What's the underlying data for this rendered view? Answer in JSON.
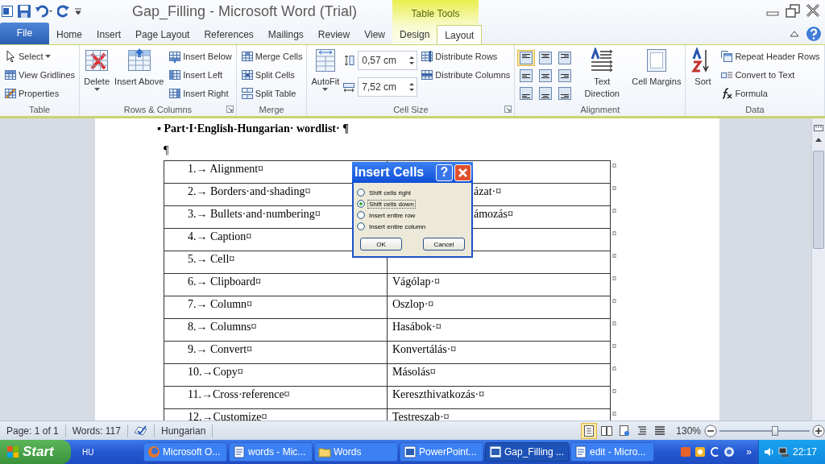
{
  "window": {
    "title": "Gap_Filling - Microsoft Word (Trial)",
    "context_label": "Table Tools"
  },
  "tabs": [
    {
      "label": "File",
      "kind": "file",
      "selected": false
    },
    {
      "label": "Home",
      "kind": "main",
      "selected": false
    },
    {
      "label": "Insert",
      "kind": "main",
      "selected": false
    },
    {
      "label": "Page Layout",
      "kind": "main",
      "selected": false
    },
    {
      "label": "References",
      "kind": "main",
      "selected": false
    },
    {
      "label": "Mailings",
      "kind": "main",
      "selected": false
    },
    {
      "label": "Review",
      "kind": "main",
      "selected": false
    },
    {
      "label": "View",
      "kind": "main",
      "selected": false
    },
    {
      "label": "Design",
      "kind": "contextual",
      "selected": false
    },
    {
      "label": "Layout",
      "kind": "contextual",
      "selected": true
    }
  ],
  "ribbon": [
    {
      "title": "Table",
      "columns": [
        [
          {
            "kind": "small",
            "label": "Select",
            "dropdown": true
          },
          {
            "kind": "small",
            "label": "View Gridlines"
          },
          {
            "kind": "small",
            "label": "Properties"
          }
        ]
      ]
    },
    {
      "title": "Rows & Columns",
      "launcher": true,
      "columns": [
        [
          {
            "kind": "large",
            "label": "Delete",
            "dropdown": true
          }
        ],
        [
          {
            "kind": "large",
            "label": "Insert Above"
          }
        ],
        [
          {
            "kind": "small",
            "label": "Insert Below"
          },
          {
            "kind": "small",
            "label": "Insert Left"
          },
          {
            "kind": "small",
            "label": "Insert Right"
          }
        ]
      ]
    },
    {
      "title": "Merge",
      "columns": [
        [
          {
            "kind": "small",
            "label": "Merge Cells"
          },
          {
            "kind": "small",
            "label": "Split Cells"
          },
          {
            "kind": "small",
            "label": "Split Table"
          }
        ]
      ]
    },
    {
      "title": "Cell Size",
      "launcher": true,
      "columns": [
        [
          {
            "kind": "large",
            "label": "AutoFit",
            "dropdown": true
          }
        ],
        [
          {
            "kind": "spin",
            "value": "0,57 cm"
          },
          {
            "kind": "spin",
            "value": "7,52 cm"
          }
        ],
        [
          {
            "kind": "small",
            "label": "Distribute Rows"
          },
          {
            "kind": "small",
            "label": "Distribute Columns"
          }
        ]
      ]
    },
    {
      "title": "Alignment",
      "columns": [
        [
          {
            "kind": "align",
            "buttons": [
              {
                "selected": true
              },
              {
                "selected": false
              },
              {
                "selected": false
              },
              {
                "selected": false
              },
              {
                "selected": false
              },
              {
                "selected": false
              },
              {
                "selected": false
              },
              {
                "selected": false
              },
              {
                "selected": false
              }
            ]
          }
        ],
        [
          {
            "kind": "large",
            "label": "Text Direction"
          }
        ],
        [
          {
            "kind": "large",
            "label": "Cell Margins"
          }
        ]
      ]
    },
    {
      "title": "Data",
      "columns": [
        [
          {
            "kind": "large",
            "label": "Sort"
          }
        ],
        [
          {
            "kind": "small",
            "label": "Repeat Header Rows"
          },
          {
            "kind": "small",
            "label": "Convert to Text"
          },
          {
            "kind": "small",
            "label": "Formula"
          }
        ]
      ]
    }
  ],
  "document": {
    "heading": "▪ Part·I·English-Hungarian· wordlist· ¶",
    "blank_line": "¶",
    "rows": [
      {
        "term": "1.→ Alignment¤",
        "row_end": "¤"
      },
      {
        "term": "2.→ Borders·and·shading¤",
        "translation": "ázat·¤",
        "partly_covered": true,
        "row_end": "¤"
      },
      {
        "term": "3.→ Bullets·and·numbering¤",
        "translation": "ámozás¤",
        "partly_covered": true,
        "row_end": "¤"
      },
      {
        "term": "4.→ Caption¤",
        "row_end": "¤"
      },
      {
        "term": "5.→ Cell¤",
        "row_end": "¤"
      },
      {
        "term": "6.→ Clipboard¤",
        "translation": "Vágólap·¤",
        "row_end": "¤"
      },
      {
        "term": "7.→ Column¤",
        "translation": "Oszlop·¤",
        "row_end": "¤"
      },
      {
        "term": "8.→ Columns¤",
        "translation": "Hasábok·¤",
        "row_end": "¤"
      },
      {
        "term": "9.→ Convert¤",
        "translation": "Konvertálás·¤",
        "row_end": "¤"
      },
      {
        "term": "10.→Copy¤",
        "translation": "Másolás¤",
        "row_end": "¤"
      },
      {
        "term": "11.→Cross·reference¤",
        "translation": "Kereszthivatkozás·¤",
        "row_end": "¤"
      },
      {
        "term": "12.→Customize¤",
        "translation": "Testreszab·¤",
        "row_end": "¤"
      }
    ]
  },
  "dialog": {
    "title": "Insert Cells",
    "help": "?",
    "options": [
      {
        "label": "Shift cells right",
        "selected": false
      },
      {
        "label": "Shift cells down",
        "selected": true
      },
      {
        "label": "Insert entire row",
        "selected": false
      },
      {
        "label": "Insert entire column",
        "selected": false
      }
    ],
    "buttons": [
      "OK",
      "Cancel"
    ]
  },
  "status_bar": {
    "page": "Page: 1 of 1",
    "words": "Words: 117",
    "language": "Hungarian",
    "views": [
      {
        "selected": true
      },
      {
        "selected": false
      },
      {
        "selected": false
      },
      {
        "selected": false
      },
      {
        "selected": false
      }
    ],
    "zoom": "130%",
    "zoom_slider": {
      "level": 0.62
    }
  },
  "taskbar": {
    "start": "Start",
    "language": "HU",
    "items": [
      {
        "label": "Microsoft O...",
        "selected": false
      },
      {
        "label": "words - Mic...",
        "selected": false
      },
      {
        "label": "Words",
        "selected": false
      },
      {
        "label": "PowerPoint...",
        "selected": false
      },
      {
        "label": "Gap_Filling ...",
        "selected": true
      },
      {
        "label": "edit - Micro...",
        "selected": false
      }
    ],
    "overflow": "»",
    "clock": "22:17"
  }
}
